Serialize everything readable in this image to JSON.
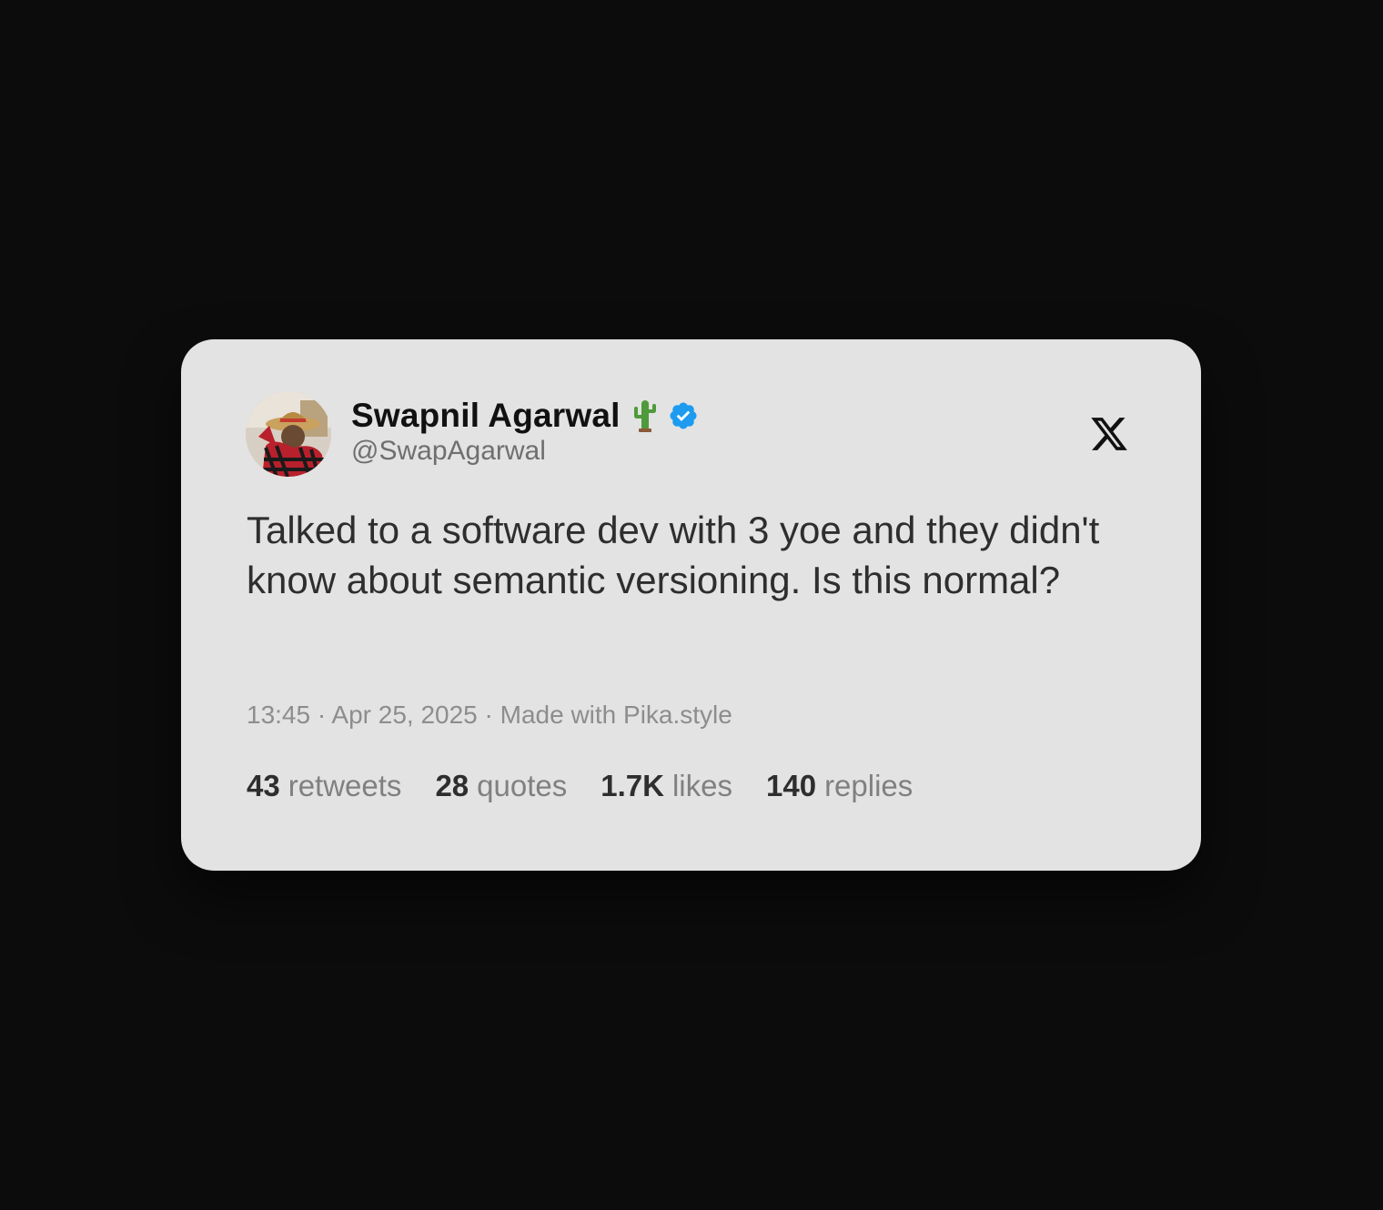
{
  "tweet": {
    "author": {
      "name": "Swapnil Agarwal",
      "name_emoji_icon": "cactus-icon",
      "verified_icon": "verified-badge-icon",
      "handle": "@SwapAgarwal"
    },
    "platform_icon": "x-logo-icon",
    "text": "Talked to a software dev with 3 yoe and they didn't know about semantic versioning. Is this normal?",
    "meta": "13:45 · Apr 25, 2025 · Made with Pika.style",
    "stats": [
      {
        "value": "43",
        "label": "retweets"
      },
      {
        "value": "28",
        "label": "quotes"
      },
      {
        "value": "1.7K",
        "label": "likes"
      },
      {
        "value": "140",
        "label": "replies"
      }
    ]
  },
  "colors": {
    "background": "#0c0c0c",
    "card": "#e3e3e3",
    "verified": "#1d9bf0",
    "cactus": "#4e9a3c"
  }
}
